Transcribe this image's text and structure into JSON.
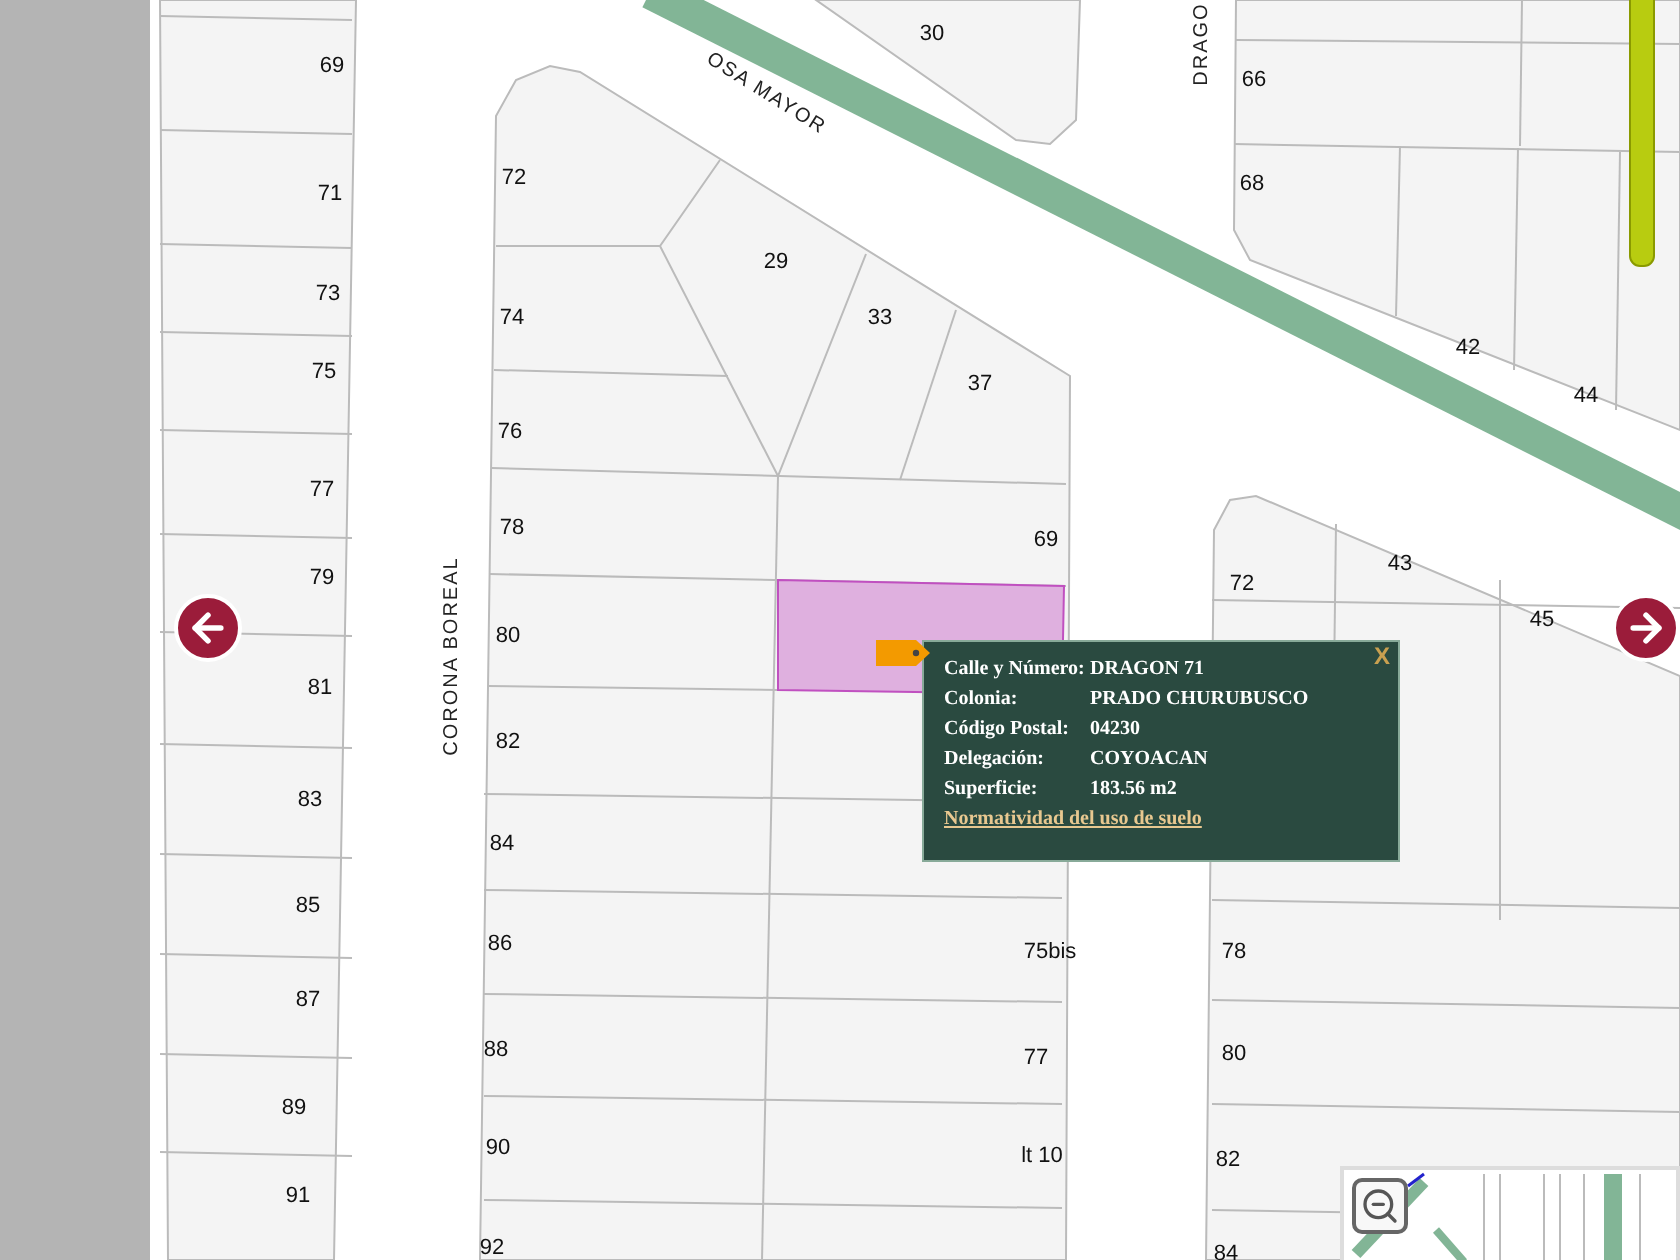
{
  "map": {
    "street_names": [
      "OSA MAYOR",
      "CORONA BOREAL",
      "DRAGO"
    ],
    "lot_numbers": [
      "69",
      "71",
      "73",
      "75",
      "77",
      "79",
      "81",
      "83",
      "85",
      "87",
      "89",
      "91",
      "30",
      "72",
      "74",
      "76",
      "78",
      "80",
      "82",
      "84",
      "86",
      "88",
      "90",
      "92",
      "29",
      "33",
      "37",
      "69",
      "66",
      "68",
      "42",
      "44",
      "72",
      "43",
      "45",
      "75bis",
      "78",
      "77",
      "80",
      "lt 10",
      "82",
      "84"
    ]
  },
  "popup": {
    "close": "X",
    "fields": [
      {
        "label": "Calle y Número:",
        "value": "DRAGON 71"
      },
      {
        "label": "Colonia:",
        "value": "PRADO CHURUBUSCO"
      },
      {
        "label": "Código Postal:",
        "value": "04230"
      },
      {
        "label": "Delegación:",
        "value": "COYOACAN"
      },
      {
        "label": "Superficie:",
        "value": "183.56 m2"
      }
    ],
    "link": "Normatividad del uso de suelo"
  }
}
